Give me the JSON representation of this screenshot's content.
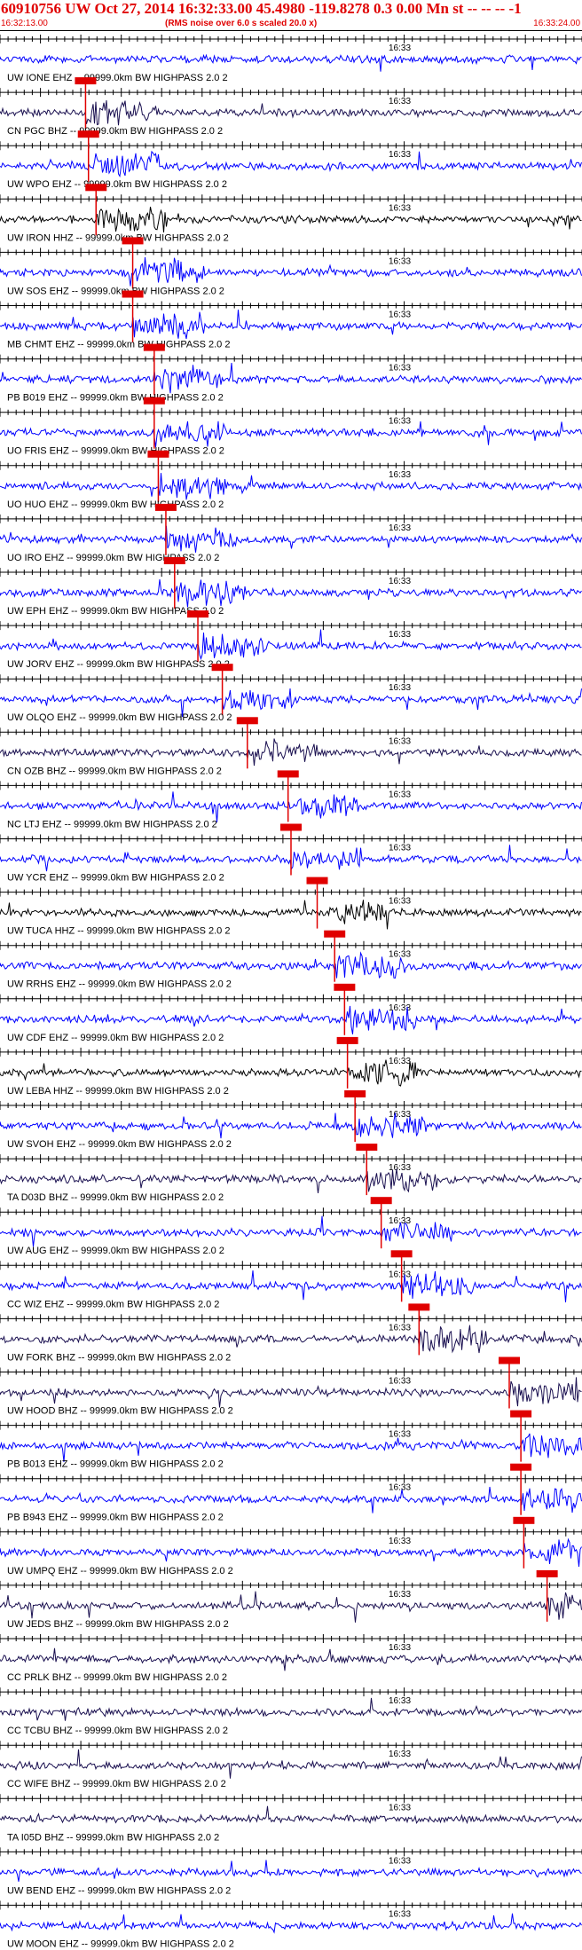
{
  "header": {
    "title": "60910756 UW Oct 27, 2014 16:32:33.00   45.4980 -119.8278  0.3 0.00 Mn st -- -- -- -1",
    "start_time": "16:32:13.00",
    "rms_note": "(RMS noise over 6.0 s scaled 20.0 x)",
    "end_time": "16:33:24.00"
  },
  "colors": {
    "header_text": "#e00000",
    "trace_blue": "#0000ff",
    "trace_dark": "#1a1050",
    "trace_black": "#000000",
    "pick": "#e00000"
  },
  "chart_data": {
    "type": "line",
    "x_range": [
      "16:32:13.00",
      "16:33:24.00"
    ],
    "minute_marker": "16:33",
    "channels": [
      {
        "label": "UW IONE EHZ -- 99999.0km BW  HIGHPASS  2.0  2",
        "color": "#0000ff",
        "pick": null
      },
      {
        "label": "CN PGC BHZ -- 99999.0km BW  HIGHPASS  2.0  2",
        "color": "#1a1050",
        "pick": 0.147
      },
      {
        "label": "UW WPO EHZ -- 99999.0km BW  HIGHPASS  2.0  2",
        "color": "#0000ff",
        "pick": 0.152
      },
      {
        "label": "UW IRON HHZ -- 99999.0km BW  HIGHPASS  2.0  2",
        "color": "#000000",
        "pick": 0.165
      },
      {
        "label": "UW SOS EHZ -- 99999.0km BW  HIGHPASS  2.0  2",
        "color": "#0000ff",
        "pick": 0.228
      },
      {
        "label": "MB CHMT EHZ -- 99999.0km BW  HIGHPASS  2.0  2",
        "color": "#0000ff",
        "pick": 0.228
      },
      {
        "label": "PB B019 EHZ -- 99999.0km BW  HIGHPASS  2.0  2",
        "color": "#0000ff",
        "pick": 0.265
      },
      {
        "label": "UO FRIS EHZ -- 99999.0km BW  HIGHPASS  2.0  2",
        "color": "#0000ff",
        "pick": 0.265
      },
      {
        "label": "UO HUO EHZ -- 99999.0km BW  HIGHPASS  2.0  2",
        "color": "#0000ff",
        "pick": 0.272
      },
      {
        "label": "UO IRO EHZ -- 99999.0km BW  HIGHPASS  2.0  2",
        "color": "#0000ff",
        "pick": 0.285
      },
      {
        "label": "UW EPH EHZ -- 99999.0km BW  HIGHPASS  2.0  2",
        "color": "#0000ff",
        "pick": 0.3
      },
      {
        "label": "UW JORV EHZ -- 99999.0km BW  HIGHPASS  2.0  2",
        "color": "#0000ff",
        "pick": 0.34
      },
      {
        "label": "UW OLQO EHZ -- 99999.0km BW  HIGHPASS  2.0  2",
        "color": "#0000ff",
        "pick": 0.382
      },
      {
        "label": "CN OZB BHZ -- 99999.0km BW  HIGHPASS  2.0  2",
        "color": "#1a1050",
        "pick": 0.425
      },
      {
        "label": "NC LTJ EHZ -- 99999.0km BW  HIGHPASS  2.0  2",
        "color": "#0000ff",
        "pick": 0.495
      },
      {
        "label": "UW YCR EHZ -- 99999.0km BW  HIGHPASS  2.0  2",
        "color": "#0000ff",
        "pick": 0.5
      },
      {
        "label": "UW TUCA HHZ -- 99999.0km BW  HIGHPASS  2.0  2",
        "color": "#000000",
        "pick": 0.545
      },
      {
        "label": "UW RRHS EHZ -- 99999.0km BW  HIGHPASS  2.0  2",
        "color": "#0000ff",
        "pick": 0.575
      },
      {
        "label": "UW CDF EHZ -- 99999.0km BW  HIGHPASS  2.0  2",
        "color": "#0000ff",
        "pick": 0.592
      },
      {
        "label": "UW LEBA HHZ -- 99999.0km BW  HIGHPASS  2.0  2",
        "color": "#000000",
        "pick": 0.597
      },
      {
        "label": "UW SVOH EHZ -- 99999.0km BW  HIGHPASS  2.0  2",
        "color": "#0000ff",
        "pick": 0.61
      },
      {
        "label": "TA D03D BHZ -- 99999.0km BW  HIGHPASS  2.0  2",
        "color": "#1a1050",
        "pick": 0.63
      },
      {
        "label": "UW AUG EHZ -- 99999.0km BW  HIGHPASS  2.0  2",
        "color": "#0000ff",
        "pick": 0.655
      },
      {
        "label": "CC WIZ EHZ -- 99999.0km BW  HIGHPASS  2.0  2",
        "color": "#0000ff",
        "pick": 0.69
      },
      {
        "label": "UW FORK BHZ -- 99999.0km BW  HIGHPASS  2.0  2",
        "color": "#1a1050",
        "pick": 0.72
      },
      {
        "label": "UW HOOD BHZ -- 99999.0km BW  HIGHPASS  2.0  2",
        "color": "#1a1050",
        "pick": 0.875
      },
      {
        "label": "PB B013 EHZ -- 99999.0km BW  HIGHPASS  2.0  2",
        "color": "#0000ff",
        "pick": 0.895
      },
      {
        "label": "PB B943 EHZ -- 99999.0km BW  HIGHPASS  2.0  2",
        "color": "#0000ff",
        "pick": 0.895
      },
      {
        "label": "UW UMPQ EHZ -- 99999.0km BW  HIGHPASS  2.0  2",
        "color": "#0000ff",
        "pick": 0.9
      },
      {
        "label": "UW JEDS BHZ -- 99999.0km BW  HIGHPASS  2.0  2",
        "color": "#1a1050",
        "pick": 0.94
      },
      {
        "label": "CC PRLK BHZ -- 99999.0km BW  HIGHPASS  2.0  2",
        "color": "#1a1050",
        "pick": null
      },
      {
        "label": "CC TCBU BHZ -- 99999.0km BW  HIGHPASS  2.0  2",
        "color": "#1a1050",
        "pick": null
      },
      {
        "label": "CC WIFE BHZ -- 99999.0km BW  HIGHPASS  2.0  2",
        "color": "#1a1050",
        "pick": null
      },
      {
        "label": "TA I05D BHZ -- 99999.0km BW  HIGHPASS  2.0  2",
        "color": "#1a1050",
        "pick": null
      },
      {
        "label": "UW BEND EHZ -- 99999.0km BW  HIGHPASS  2.0  2",
        "color": "#0000ff",
        "pick": null
      },
      {
        "label": "UW MOON EHZ -- 99999.0km BW  HIGHPASS  2.0  2",
        "color": "#0000ff",
        "pick": null
      }
    ]
  }
}
